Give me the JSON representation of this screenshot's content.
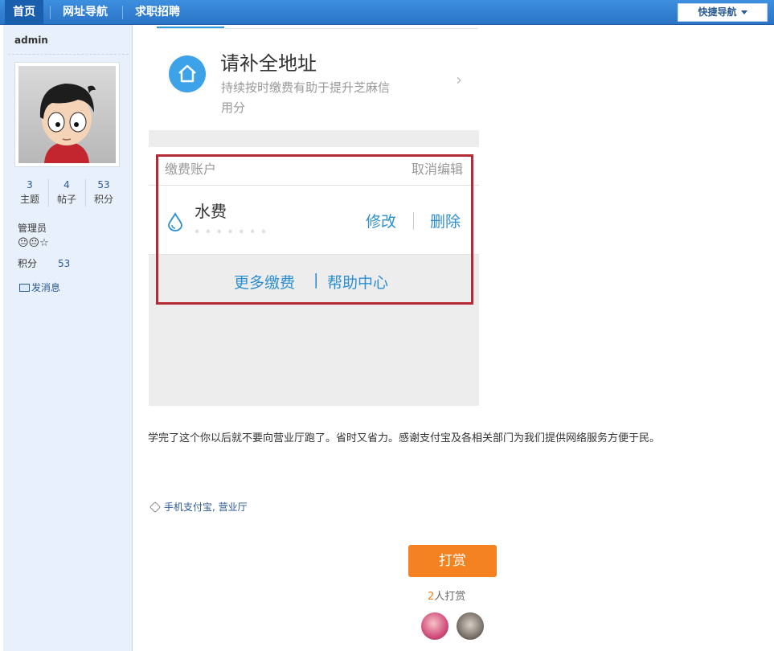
{
  "nav": {
    "items": [
      "首页",
      "网址导航",
      "求职招聘"
    ],
    "quick_nav": "快捷导航"
  },
  "sidebar": {
    "username": "admin",
    "stats": [
      {
        "value": "3",
        "label": "主题"
      },
      {
        "value": "4",
        "label": "帖子"
      },
      {
        "value": "53",
        "label": "积分"
      }
    ],
    "role": "管理员",
    "medals": "😐😐☆",
    "points_label": "积分",
    "points_value": "53",
    "pm_label": "发消息"
  },
  "screenshot": {
    "address_title": "请补全地址",
    "address_subtitle": "持续按时缴费有助于提升芝麻信用分",
    "pay_account_label": "缴费账户",
    "cancel_edit": "取消编辑",
    "water_fee": "水费",
    "account_masked": "* * * * * * *",
    "edit": "修改",
    "delete": "删除",
    "more_pay": "更多缴费",
    "links_sep": "|",
    "help_center": "帮助中心"
  },
  "post": {
    "text": "学完了这个你以后就不要向营业厅跑了。省时又省力。感谢支付宝及各相关部门为我们提供网络服务方便于民。",
    "tags": "手机支付宝, 营业厅",
    "reward_button": "打赏",
    "reward_num": "2",
    "reward_suffix": "人打赏"
  },
  "colors": {
    "nav_bg": "#2b74c6",
    "accent_blue": "#2d8fd0",
    "highlight_red": "#b52b35",
    "reward_orange": "#f58220"
  }
}
